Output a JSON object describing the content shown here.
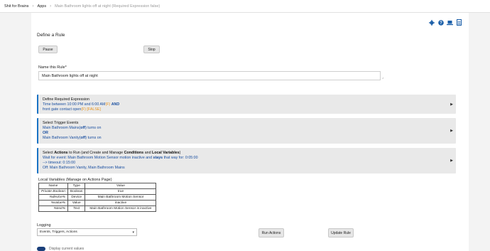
{
  "breadcrumb": {
    "hub": "Shit for Brains",
    "apps": "Apps",
    "current": "Main Bathroom lights off at night  (Required Expression false)"
  },
  "icons": [
    "gear-icon",
    "help-icon",
    "laptop-icon",
    "document-icon"
  ],
  "page_title": "Define a Rule",
  "buttons": {
    "pause": "Pause",
    "stop": "Stop",
    "run_actions": "Run Actions",
    "update_rule": "Update Rule"
  },
  "name_field": {
    "label": "Name this Rule*",
    "value": "Main Bathroom lights off at night"
  },
  "required_expression": {
    "heading": "Define Required Expression",
    "line1": "Time between 10:00 PM and 6:00 AM",
    "line1_flag": "(F)",
    "line1_op": "AND",
    "line2": "front gate contact open",
    "line2_flag": "(F) [FALSE]"
  },
  "trigger_events": {
    "heading": "Select Trigger Events",
    "line1_pre": "Main Bathroom Mains(",
    "line1_bold": "off",
    "line1_post": ") turns on",
    "or": "OR",
    "line2_pre": "Main Bathroom Vanity(",
    "line2_bold": "off",
    "line2_post": ") turns on"
  },
  "actions": {
    "heading_pre": "Select ",
    "heading_b1": "Actions",
    "heading_mid1": " to Run (and Create and Manage ",
    "heading_b2": "Conditions",
    "heading_mid2": " and ",
    "heading_b3": "Local Variables",
    "heading_post": ")",
    "line1_pre": "Wait for event: Main Bathroom Motion Sensor motion inactive and ",
    "line1_bold": "stays",
    "line1_post": " that way for: 0:05:00",
    "line2": " --> timeout: 0:15:00",
    "line3": "Off: Main Bathroom Vanity, Main Bathroom Mains"
  },
  "local_variables": {
    "title": "Local Variables",
    "link": "(Manage on Actions Page)",
    "columns": [
      "Name",
      "Type",
      "Value"
    ],
    "rows": [
      [
        "Private Boolean",
        "Boolean",
        "true"
      ],
      [
        "%device%",
        "Device",
        "Main Bathroom Motion Sensor"
      ],
      [
        "%value%",
        "Value",
        "inactive"
      ],
      [
        "%text%",
        "Text",
        "Main Bathroom Motion Sensor is inactive"
      ]
    ]
  },
  "logging": {
    "label": "Logging",
    "selected": "Events, Triggers, Actions"
  },
  "footer": {
    "label": "Display current values"
  },
  "arrow": "▶",
  "resize": "⌟"
}
